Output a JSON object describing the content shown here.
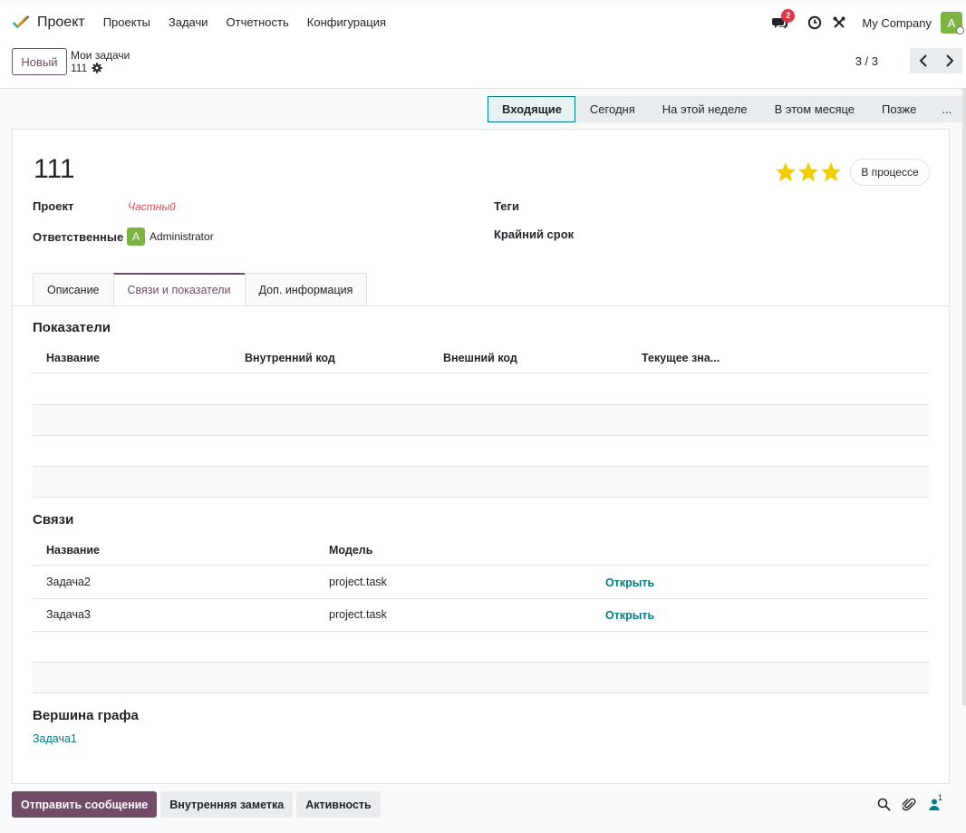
{
  "navbar": {
    "app_name": "Проект",
    "menu": [
      "Проекты",
      "Задачи",
      "Отчетность",
      "Конфигурация"
    ],
    "messages_count": "2",
    "company": "My Company",
    "user_initial": "A"
  },
  "control": {
    "new_label": "Новый",
    "breadcrumb_parent": "Мои задачи",
    "record_name": "111",
    "pager": "3 / 3"
  },
  "statusbar": {
    "stages": [
      "Входящие",
      "Сегодня",
      "На этой неделе",
      "В этом месяце",
      "Позже",
      "..."
    ],
    "active_index": 0
  },
  "form": {
    "title": "111",
    "priority_stars": 3,
    "state": "В процессе",
    "project_label": "Проект",
    "project_value": "Частный",
    "assignees_label": "Ответственные",
    "assignee_initial": "A",
    "assignee_name": "Administrator",
    "tags_label": "Теги",
    "deadline_label": "Крайний срок"
  },
  "tabs": [
    "Описание",
    "Связи и показатели",
    "Доп. информация"
  ],
  "indicators": {
    "title": "Показатели",
    "columns": [
      "Название",
      "Внутренний код",
      "Внешний код",
      "Текущее зна..."
    ]
  },
  "links": {
    "title": "Связи",
    "columns": [
      "Название",
      "Модель"
    ],
    "rows": [
      {
        "name": "Задача2",
        "model": "project.task",
        "action": "Открыть"
      },
      {
        "name": "Задача3",
        "model": "project.task",
        "action": "Открыть"
      }
    ]
  },
  "graph": {
    "title": "Вершина графа",
    "value": "Задача1"
  },
  "chatter": {
    "send_message": "Отправить сообщение",
    "internal_note": "Внутренняя заметка",
    "activity": "Активность",
    "followers_count": "1"
  }
}
